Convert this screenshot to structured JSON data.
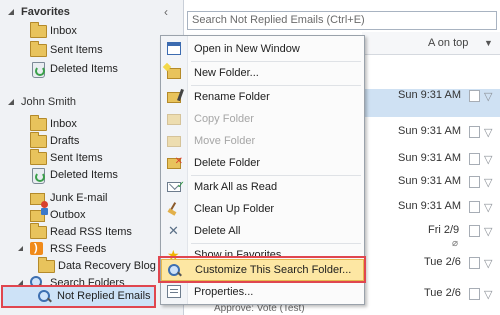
{
  "nav": {
    "favorites": {
      "header": "Favorites",
      "items": [
        "Inbox",
        "Sent Items",
        "Deleted Items"
      ]
    },
    "account": {
      "header": "John Smith",
      "items": [
        "Inbox",
        "Drafts",
        "Sent Items",
        "Deleted Items",
        "Junk E-mail",
        "Outbox",
        "Read RSS Items",
        "RSS Feeds",
        "Data Recovery Blog",
        "Search Folders",
        "Not Replied Emails"
      ]
    }
  },
  "search": {
    "placeholder": "Search Not Replied Emails (Ctrl+E)"
  },
  "list": {
    "sort_label": "A on top",
    "rows": [
      {
        "time": "Sun 9:31 AM"
      },
      {
        "time": "Sun 9:31 AM"
      },
      {
        "time": "Sun 9:31 AM"
      },
      {
        "time": "Sun 9:31 AM"
      },
      {
        "time": "Sun 9:31 AM"
      },
      {
        "time": "Fri 2/9"
      },
      {
        "time": "Tue 2/6"
      },
      {
        "time": "Tue 2/6"
      }
    ],
    "footer_preview": "Approve: Vote (Test)"
  },
  "context_menu": {
    "items": [
      {
        "label": "Open in New Window",
        "accel": "W",
        "icon": "window-icon",
        "enabled": true
      },
      {
        "label": "New Folder...",
        "accel": "N",
        "icon": "new-folder-icon",
        "enabled": true
      },
      {
        "label": "Rename Folder",
        "accel": "R",
        "icon": "rename-folder-icon",
        "enabled": true
      },
      {
        "label": "Copy Folder",
        "accel": "C",
        "icon": "copy-folder-icon",
        "enabled": false
      },
      {
        "label": "Move Folder",
        "accel": "M",
        "icon": "move-folder-icon",
        "enabled": false
      },
      {
        "label": "Delete Folder",
        "accel": "D",
        "icon": "delete-folder-icon",
        "enabled": true
      },
      {
        "label": "Mark All as Read",
        "accel": "R",
        "icon": "mark-read-icon",
        "enabled": true
      },
      {
        "label": "Clean Up Folder",
        "accel": "F",
        "icon": "clean-up-icon",
        "enabled": true
      },
      {
        "label": "Delete All",
        "accel": "A",
        "icon": "delete-all-icon",
        "enabled": true
      },
      {
        "label": "Show in Favorites",
        "accel": "F",
        "icon": "favorites-star-icon",
        "enabled": true
      },
      {
        "label": "Customize This Search Folder...",
        "accel": "z",
        "icon": "search-folder-icon",
        "enabled": true,
        "highlighted": true
      },
      {
        "label": "Properties...",
        "accel": "P",
        "icon": "properties-icon",
        "enabled": true
      }
    ]
  }
}
